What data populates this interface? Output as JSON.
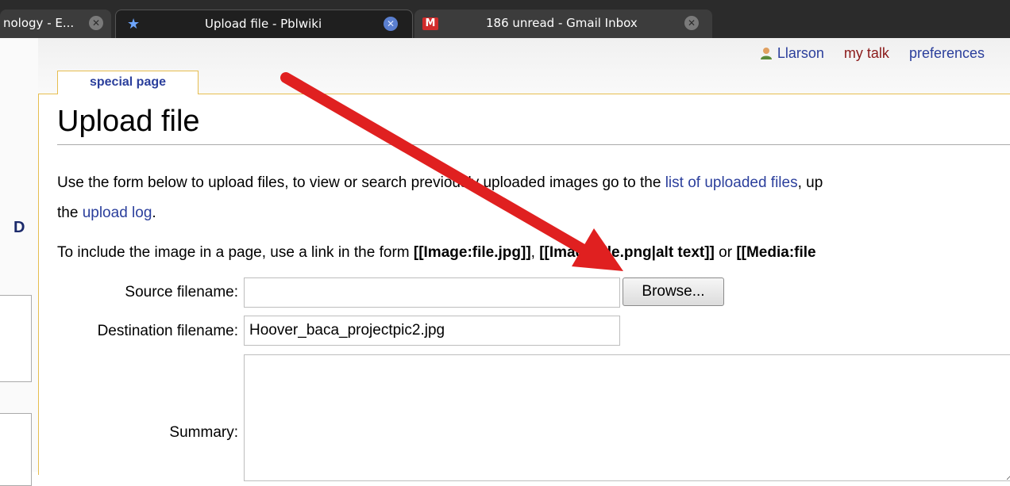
{
  "browser": {
    "tabs": [
      {
        "label": "nology - E...",
        "active": false
      },
      {
        "label": "Upload file - Pblwiki",
        "active": true
      },
      {
        "label": "186 unread - Gmail Inbox",
        "active": false
      }
    ]
  },
  "userbar": {
    "username": "Llarson",
    "talk": "my talk",
    "preferences": "preferences"
  },
  "page": {
    "tab_label": "special page",
    "title": "Upload file",
    "intro_part1": "Use the form below to upload files, to view or search previously uploaded images go to the ",
    "intro_link1": "list of uploaded files",
    "intro_part2": ", up",
    "intro_line2_part1": "the ",
    "intro_link2": "upload log",
    "intro_line2_part2": ".",
    "include_part1": "To include the image in a page, use a link in the form ",
    "include_code1": "[[Image:file.jpg]]",
    "include_sep": ", ",
    "include_code2": "[[Image:file.png|alt text]]",
    "include_or": " or ",
    "include_code3": "[[Media:file"
  },
  "form": {
    "source_label": "Source filename:",
    "source_value": "",
    "browse_label": "Browse...",
    "dest_label": "Destination filename:",
    "dest_value": "Hoover_baca_projectpic2.jpg",
    "summary_label": "Summary:",
    "summary_value": ""
  },
  "sidebar": {
    "letter": "D"
  },
  "colors": {
    "link": "#2b3f9c",
    "arrow": "#e02020",
    "tab_border": "#e6bd4f"
  }
}
